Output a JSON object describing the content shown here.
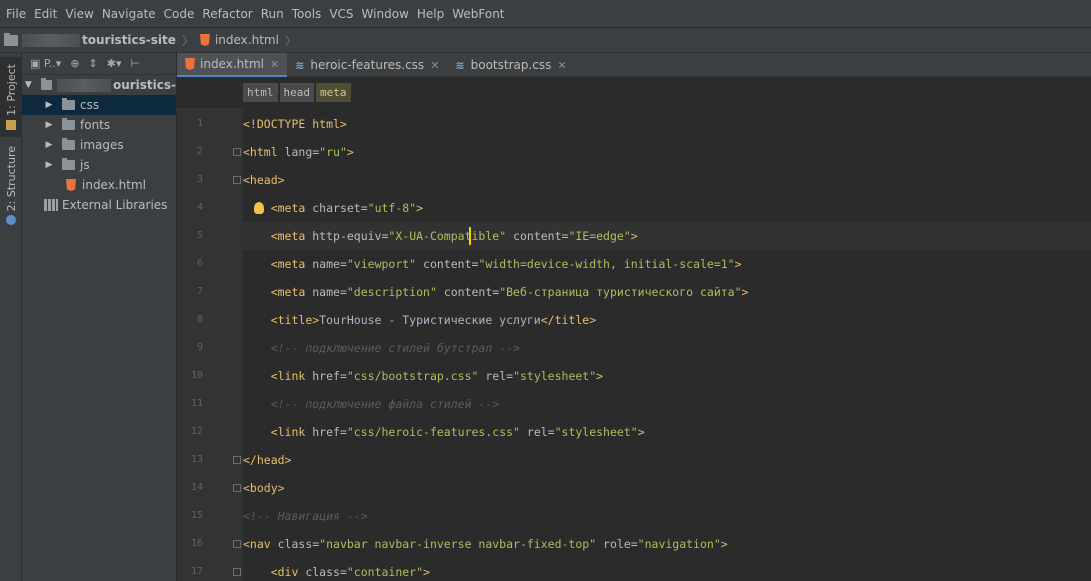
{
  "menu": [
    "File",
    "Edit",
    "View",
    "Navigate",
    "Code",
    "Refactor",
    "Run",
    "Tools",
    "VCS",
    "Window",
    "Help",
    "WebFont"
  ],
  "breadcrumb": {
    "project": "touristics-site",
    "file": "index.html"
  },
  "left_stripe": {
    "project_tab": "1: Project",
    "structure_tab": "2: Structure"
  },
  "project_panel": {
    "view_label": "P..▾",
    "root": "ouristics-",
    "items": [
      {
        "label": "css",
        "type": "folder",
        "selected": true
      },
      {
        "label": "fonts",
        "type": "folder"
      },
      {
        "label": "images",
        "type": "folder"
      },
      {
        "label": "js",
        "type": "folder"
      },
      {
        "label": "index.html",
        "type": "file"
      },
      {
        "label": "External Libraries",
        "type": "library"
      }
    ]
  },
  "tabs": [
    {
      "label": "index.html",
      "icon": "html5-icon",
      "active": true
    },
    {
      "label": "heroic-features.css",
      "icon": "css-icon",
      "active": false
    },
    {
      "label": "bootstrap.css",
      "icon": "css-icon",
      "active": false
    }
  ],
  "tag_path": [
    "html",
    "head",
    "meta"
  ],
  "code_lines": [
    {
      "n": "1",
      "segs": [
        [
          "doc",
          "<!DOCTYPE html>"
        ]
      ]
    },
    {
      "n": "2",
      "segs": [
        [
          "tag",
          "<html "
        ],
        [
          "attr",
          "lang="
        ],
        [
          "val",
          "\"ru\""
        ],
        [
          "tag",
          ">"
        ]
      ]
    },
    {
      "n": "3",
      "segs": [
        [
          "tag",
          "<head>"
        ]
      ]
    },
    {
      "n": "4",
      "segs": [
        [
          "text",
          "    "
        ],
        [
          "tag",
          "<meta "
        ],
        [
          "attr",
          "charset="
        ],
        [
          "val",
          "\"utf-8\""
        ],
        [
          "tag",
          ">"
        ]
      ]
    },
    {
      "n": "5",
      "segs": [
        [
          "text",
          "    "
        ],
        [
          "tag",
          "<meta "
        ],
        [
          "attr",
          "http-equiv="
        ],
        [
          "val",
          "\"X-UA-Compatible\""
        ],
        [
          "attr",
          " content="
        ],
        [
          "val",
          "\"IE=edge\""
        ],
        [
          "tag",
          ">"
        ]
      ]
    },
    {
      "n": "6",
      "segs": [
        [
          "text",
          "    "
        ],
        [
          "tag",
          "<meta "
        ],
        [
          "attr",
          "name="
        ],
        [
          "val",
          "\"viewport\""
        ],
        [
          "attr",
          " content="
        ],
        [
          "val",
          "\"width=device-width, initial-scale=1\""
        ],
        [
          "tag",
          ">"
        ]
      ]
    },
    {
      "n": "7",
      "segs": [
        [
          "text",
          "    "
        ],
        [
          "tag",
          "<meta "
        ],
        [
          "attr",
          "name="
        ],
        [
          "val",
          "\"description\""
        ],
        [
          "attr",
          " content="
        ],
        [
          "val",
          "\"Веб-страница туристического сайта\""
        ],
        [
          "tag",
          ">"
        ]
      ]
    },
    {
      "n": "8",
      "segs": [
        [
          "text",
          "    "
        ],
        [
          "tag",
          "<title>"
        ],
        [
          "text",
          "TourHouse - Туристические услуги"
        ],
        [
          "tag",
          "</title>"
        ]
      ]
    },
    {
      "n": "9",
      "segs": [
        [
          "text",
          "    "
        ],
        [
          "com2",
          "<!-- подключение стилей бутстрап -->"
        ]
      ]
    },
    {
      "n": "10",
      "segs": [
        [
          "text",
          "    "
        ],
        [
          "tag",
          "<link "
        ],
        [
          "attr",
          "href="
        ],
        [
          "val",
          "\"css/bootstrap.css\""
        ],
        [
          "attr",
          " rel="
        ],
        [
          "val",
          "\"stylesheet\""
        ],
        [
          "tag",
          ">"
        ]
      ]
    },
    {
      "n": "11",
      "segs": [
        [
          "text",
          "    "
        ],
        [
          "com2",
          "<!-- подключение файла стилей -->"
        ]
      ]
    },
    {
      "n": "12",
      "segs": [
        [
          "text",
          "    "
        ],
        [
          "tag",
          "<link "
        ],
        [
          "attr",
          "href="
        ],
        [
          "val",
          "\"css/heroic-features.css\""
        ],
        [
          "attr",
          " rel="
        ],
        [
          "val",
          "\"stylesheet\""
        ],
        [
          "tag",
          ">"
        ]
      ]
    },
    {
      "n": "13",
      "segs": [
        [
          "tag",
          "</head>"
        ]
      ]
    },
    {
      "n": "14",
      "segs": [
        [
          "tag",
          "<body>"
        ]
      ]
    },
    {
      "n": "15",
      "segs": [
        [
          "com2",
          "<!-- Навигация -->"
        ]
      ]
    },
    {
      "n": "16",
      "segs": [
        [
          "tag",
          "<nav "
        ],
        [
          "attr",
          "class="
        ],
        [
          "val",
          "\"navbar navbar-inverse navbar-fixed-top\""
        ],
        [
          "attr",
          " role="
        ],
        [
          "val",
          "\"navigation\""
        ],
        [
          "tag",
          ">"
        ]
      ]
    },
    {
      "n": "17",
      "segs": [
        [
          "text",
          "    "
        ],
        [
          "tag",
          "<div "
        ],
        [
          "attr",
          "class="
        ],
        [
          "val",
          "\"container\""
        ],
        [
          "tag",
          ">"
        ]
      ]
    }
  ],
  "current_line": 5,
  "colors": {
    "tag": "#e8bf6a",
    "attr": "#bababa",
    "value": "#a5c25c",
    "comment": "#5a5c5e",
    "selection": "#0d293e"
  }
}
